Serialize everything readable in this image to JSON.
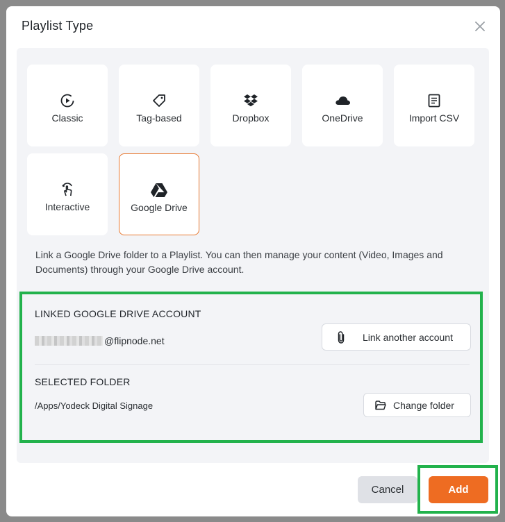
{
  "modal": {
    "title": "Playlist Type"
  },
  "tiles": [
    {
      "label": "Classic",
      "icon": "play-circle-icon"
    },
    {
      "label": "Tag-based",
      "icon": "tag-icon"
    },
    {
      "label": "Dropbox",
      "icon": "dropbox-icon"
    },
    {
      "label": "OneDrive",
      "icon": "cloud-icon"
    },
    {
      "label": "Import CSV",
      "icon": "document-icon"
    },
    {
      "label": "Interactive",
      "icon": "touch-icon"
    },
    {
      "label": "Google Drive",
      "icon": "google-drive-icon",
      "selected": true
    }
  ],
  "description": "Link a Google Drive folder to a Playlist. You can then manage your content (Video, Images and Documents) through your Google Drive account.",
  "linked": {
    "heading": "LINKED GOOGLE DRIVE ACCOUNT",
    "email_domain": "@flipnode.net",
    "link_button": "Link another account"
  },
  "folder": {
    "heading": "SELECTED FOLDER",
    "path": "/Apps/Yodeck Digital Signage",
    "change_button": "Change folder"
  },
  "footer": {
    "cancel": "Cancel",
    "add": "Add"
  },
  "colors": {
    "accent": "#ee6c22",
    "highlight": "#22b24c"
  }
}
